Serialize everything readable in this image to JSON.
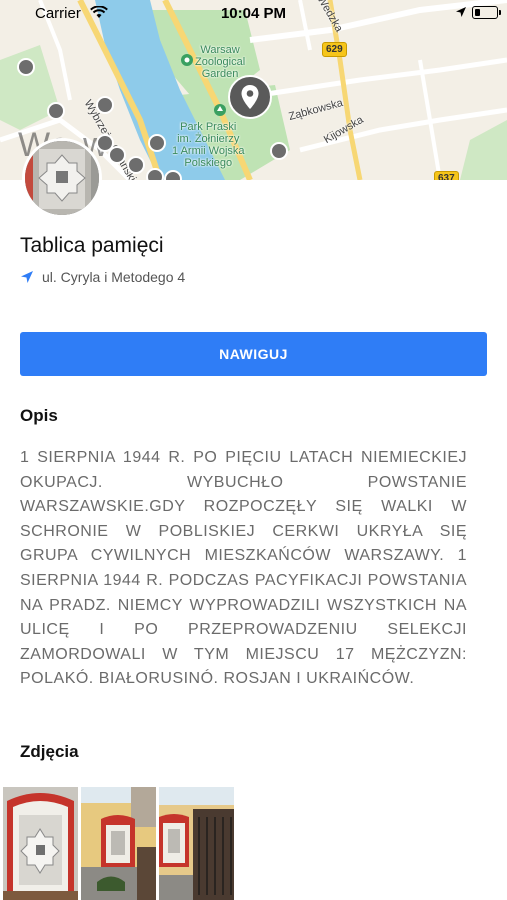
{
  "status_bar": {
    "carrier": "Carrier",
    "time": "10:04 PM",
    "battery_level": 0.25
  },
  "map": {
    "labels": {
      "zoo": "Warsaw\nZoological\nGarden",
      "park": "Park Praski\nim. Żołnierzy\n1 Armii Wojska\nPolskiego",
      "wybrzeze": "Wybrzeże Gdańskie",
      "zabkowska": "Ząbkowska",
      "kijowska": "Kijowska",
      "jagiellonska_fragment": "Wedzka",
      "city": "Wa    w"
    },
    "road_badges": [
      "629",
      "637"
    ],
    "colors": {
      "river": "#8ecbea",
      "park": "#bfe3b4",
      "road_major": "#f7d774",
      "land": "#f3efe6"
    }
  },
  "place": {
    "title": "Tablica pamięci",
    "address": "ul. Cyryla i Metodego 4",
    "navigate_label": "NAWIGUJ"
  },
  "description": {
    "heading": "Opis",
    "text": "1 SIERPNIA 1944 R. PO PIĘCIU LATACH NIEMIECKIEJ OKUPACJ. WYBUCHŁO POWSTANIE WARSZAWSKIE.GDY ROZPOCZĘŁY SIĘ WALKI W SCHRONIE W POBLISKIEJ CERKWI UKRYŁA SIĘ GRUPA CYWILNYCH MIESZKAŃCÓW WARSZAWY. 1 SIERPNIA 1944 R. PODCZAS PACYFIKACJI POWSTANIA NA PRADZ. NIEMCY WYPROWADZILI WSZYSTKICH NA ULICĘ I PO PRZEPROWADZENIU SELEKCJI ZAMORDOWALI W TYM MIEJSCU 17 MĘŻCZYZN: POLAKÓ. BIAŁORUSINÓ. ROSJAN I UKRAIŃCÓW."
  },
  "photos": {
    "heading": "Zdjęcia"
  },
  "theme": {
    "accent": "#2f7df6",
    "pin": "#5a5a5a"
  }
}
